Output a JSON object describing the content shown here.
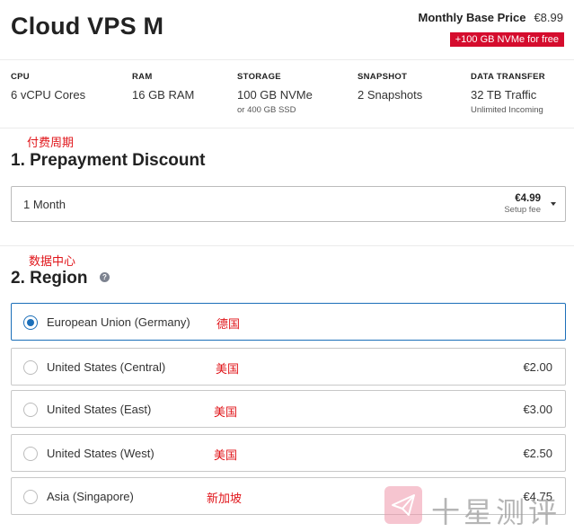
{
  "header": {
    "title": "Cloud VPS M",
    "price_label": "Monthly Base Price",
    "price_value": "€8.99",
    "promo": "+100 GB NVMe for free"
  },
  "specs": [
    {
      "label": "CPU",
      "value": "6 vCPU Cores",
      "sub": ""
    },
    {
      "label": "RAM",
      "value": "16 GB RAM",
      "sub": ""
    },
    {
      "label": "STORAGE",
      "value": "100 GB NVMe",
      "sub": "or 400 GB SSD"
    },
    {
      "label": "SNAPSHOT",
      "value": "2 Snapshots",
      "sub": ""
    },
    {
      "label": "DATA TRANSFER",
      "value": "32 TB Traffic",
      "sub": "Unlimited Incoming"
    }
  ],
  "prepayment": {
    "annotation": "付费周期",
    "title": "1. Prepayment Discount",
    "selected": "1 Month",
    "fee_amount": "€4.99",
    "fee_label": "Setup fee"
  },
  "region": {
    "annotation": "数据中心",
    "title": "2. Region",
    "help_glyph": "?",
    "options": [
      {
        "label": "European Union (Germany)",
        "price": "",
        "note": "德国",
        "selected": true
      },
      {
        "label": "United States (Central)",
        "price": "€2.00",
        "note": "美国",
        "selected": false
      },
      {
        "label": "United States (East)",
        "price": "€3.00",
        "note": "美国",
        "selected": false
      },
      {
        "label": "United States (West)",
        "price": "€2.50",
        "note": "美国",
        "selected": false
      },
      {
        "label": "Asia (Singapore)",
        "price": "€4.75",
        "note": "新加坡",
        "selected": false
      }
    ]
  },
  "watermark": {
    "text": "十星测评"
  },
  "colors": {
    "accent": "#1c6fb9",
    "promo": "#d50c2d",
    "annotation": "#e0151a"
  }
}
